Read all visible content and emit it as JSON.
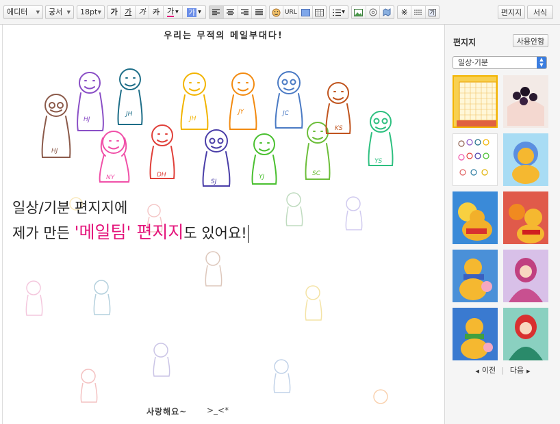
{
  "toolbar": {
    "mode_select": "에디터",
    "font_select": "궁서",
    "size_select": "18pt",
    "bold": "가",
    "underline": "가",
    "italic": "가",
    "strike": "가",
    "fontcolor": "가",
    "bgcolor": "가",
    "url": "URL",
    "special_char": "가",
    "letter_button": "편지지",
    "format_button": "서식"
  },
  "letter": {
    "heading": "우리는 무적의 메일부대다!",
    "footer": "사랑해요~",
    "footer_emote": ">_<*",
    "doodle_initials": [
      "HJ",
      "HJ",
      "JH",
      "JH",
      "JY",
      "JC",
      "KS",
      "YS",
      "NY",
      "DH",
      "SJ",
      "YJ",
      "SC"
    ]
  },
  "editor": {
    "line1": "일상/기분 편지지에",
    "line2_pre": "제가 만든 ",
    "line2_highlight": "'메일팀' 편지지",
    "line2_post": "도 있어요!",
    "highlight_color": "#e4147b"
  },
  "panel": {
    "title": "편지지",
    "unuse_button": "사용안함",
    "category": "일상·기분",
    "prev": "이전",
    "next": "다음",
    "thumbnails": [
      {
        "name": "yellow-grid-letter",
        "selected": true
      },
      {
        "name": "blueberry-cake"
      },
      {
        "name": "mail-team-doodles"
      },
      {
        "name": "pooh-blue-hood"
      },
      {
        "name": "pooh-sun"
      },
      {
        "name": "pooh-tigger"
      },
      {
        "name": "pooh-piglet-winter"
      },
      {
        "name": "belle-winter"
      },
      {
        "name": "pooh-piglet-scarf"
      },
      {
        "name": "ariel-winter"
      }
    ]
  }
}
